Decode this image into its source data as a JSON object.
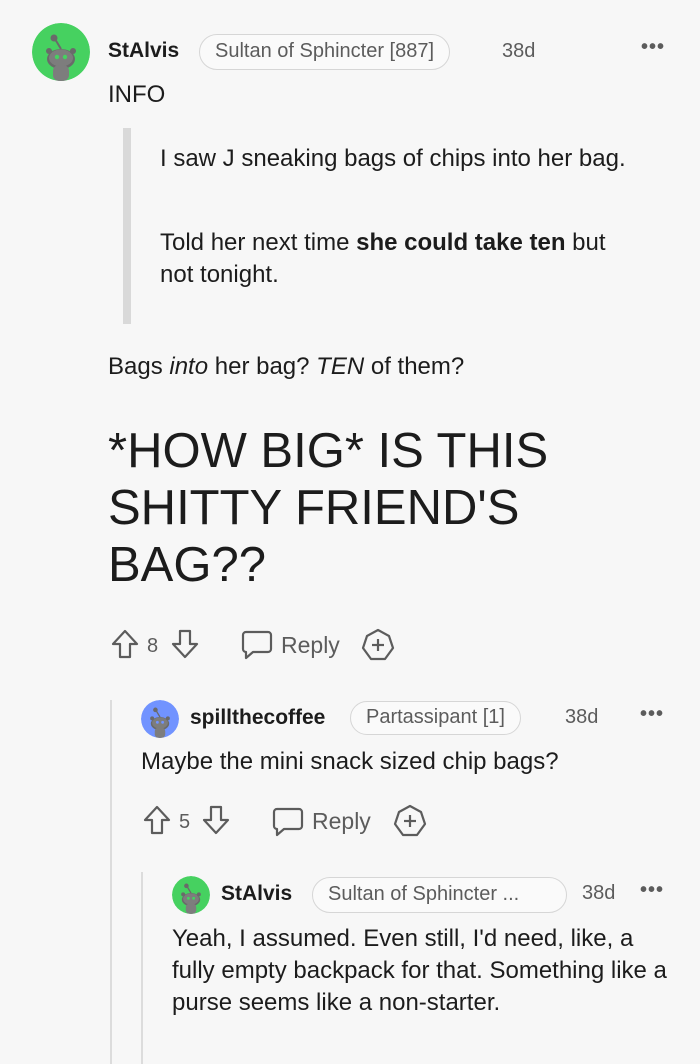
{
  "comment1": {
    "username": "StAlvis",
    "flair": "Sultan of Sphincter [887]",
    "age": "38d",
    "more": "•••",
    "info_line": "INFO",
    "quote_p1": "I saw J sneaking bags of chips into her bag.",
    "quote_p2_prefix": "Told her next time ",
    "quote_p2_bold": "she could take ten",
    "quote_p2_suffix": " but not tonight.",
    "line_a": "Bags ",
    "line_b": "into",
    "line_c": " her bag? ",
    "line_d": "TEN",
    "line_e": " of them?",
    "heading": "*HOW BIG* IS THIS SHITTY FRIEND'S BAG??",
    "votes": "8",
    "reply_label": "Reply"
  },
  "comment2": {
    "username": "spillthecoffee",
    "flair": "Partassipant [1]",
    "age": "38d",
    "more": "•••",
    "body": "Maybe the mini snack sized chip bags?",
    "votes": "5",
    "reply_label": "Reply"
  },
  "comment3": {
    "username": "StAlvis",
    "flair": "Sultan of Sphincter ...",
    "age": "38d",
    "more": "•••",
    "body": "Yeah, I assumed. Even still, I'd need, like, a fully empty backpack for that. Something like a purse seems like a non-starter."
  },
  "colors": {
    "avatar_green": "#46d160",
    "avatar_blue": "#7193ff",
    "text": "#1c1c1c",
    "meta": "#5c5c5c"
  },
  "icons": [
    "snoo-avatar-icon",
    "upvote-icon",
    "downvote-icon",
    "reply-icon",
    "award-icon",
    "more-options-icon"
  ]
}
